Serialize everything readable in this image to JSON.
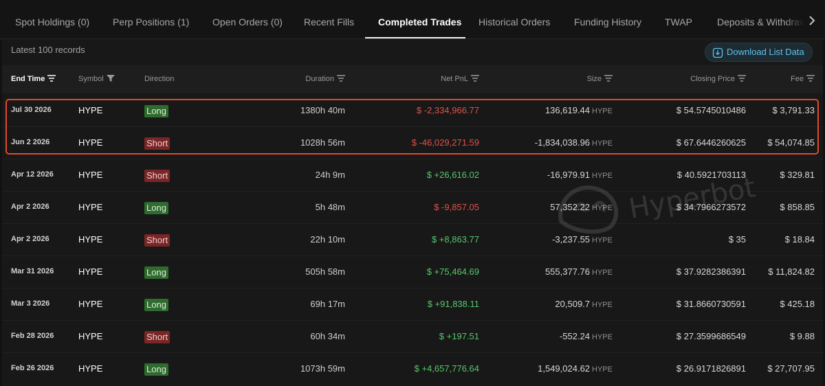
{
  "tabs": [
    {
      "label": "Spot Holdings (0)"
    },
    {
      "label": "Perp Positions (1)"
    },
    {
      "label": "Open Orders (0)"
    },
    {
      "label": "Recent Fills"
    },
    {
      "label": "Completed Trades"
    },
    {
      "label": "Historical Orders"
    },
    {
      "label": "Funding History"
    },
    {
      "label": "TWAP"
    },
    {
      "label": "Deposits & Withdrav"
    }
  ],
  "active_tab": "Completed Trades",
  "records_label": "Latest 100 records",
  "download_label": "Download List Data",
  "columns": {
    "end_time": "End Time",
    "symbol": "Symbol",
    "direction": "Direction",
    "duration": "Duration",
    "net_pnl": "Net PnL",
    "size": "Size",
    "closing_price": "Closing Price",
    "fee": "Fee"
  },
  "size_unit": "HYPE",
  "watermark": "Hyperbot",
  "colors": {
    "long": "#2f6b2f",
    "short": "#7a2626",
    "pnl_positive": "#55c96b",
    "pnl_negative": "#e0524a",
    "highlight": "#e34a2a",
    "accent": "#5cc4ee"
  },
  "rows": [
    {
      "date": "Jul 30 2026",
      "symbol": "HYPE",
      "direction": "Long",
      "duration": "1380h 40m",
      "pnl": "$ -2,334,966.77",
      "pnl_sign": "neg",
      "size": "136,619.44",
      "price": "$ 54.5745010486",
      "fee": "$ 3,791.33"
    },
    {
      "date": "Jun 2 2026",
      "symbol": "HYPE",
      "direction": "Short",
      "duration": "1028h 56m",
      "pnl": "$ -46,029,271.59",
      "pnl_sign": "neg",
      "size": "-1,834,038.96",
      "price": "$ 67.6446260625",
      "fee": "$ 54,074.85"
    },
    {
      "date": "Apr 12 2026",
      "symbol": "HYPE",
      "direction": "Short",
      "duration": "24h 9m",
      "pnl": "$ +26,616.02",
      "pnl_sign": "pos",
      "size": "-16,979.91",
      "price": "$ 40.5921703113",
      "fee": "$ 329.81"
    },
    {
      "date": "Apr 2 2026",
      "symbol": "HYPE",
      "direction": "Long",
      "duration": "5h 48m",
      "pnl": "$ -9,857.05",
      "pnl_sign": "neg",
      "size": "57,352.22",
      "price": "$ 34.7966273572",
      "fee": "$ 858.85"
    },
    {
      "date": "Apr 2 2026",
      "symbol": "HYPE",
      "direction": "Short",
      "duration": "22h 10m",
      "pnl": "$ +8,863.77",
      "pnl_sign": "pos",
      "size": "-3,237.55",
      "price": "$ 35",
      "fee": "$ 18.84"
    },
    {
      "date": "Mar 31 2026",
      "symbol": "HYPE",
      "direction": "Long",
      "duration": "505h 58m",
      "pnl": "$ +75,464.69",
      "pnl_sign": "pos",
      "size": "555,377.76",
      "price": "$ 37.9282386391",
      "fee": "$ 11,824.82"
    },
    {
      "date": "Mar 3 2026",
      "symbol": "HYPE",
      "direction": "Long",
      "duration": "69h 17m",
      "pnl": "$ +91,838.11",
      "pnl_sign": "pos",
      "size": "20,509.7",
      "price": "$ 31.8660730591",
      "fee": "$ 425.18"
    },
    {
      "date": "Feb 28 2026",
      "symbol": "HYPE",
      "direction": "Short",
      "duration": "60h 34m",
      "pnl": "$ +197.51",
      "pnl_sign": "pos",
      "size": "-552.24",
      "price": "$ 27.3599686549",
      "fee": "$ 9.88"
    },
    {
      "date": "Feb 26 2026",
      "symbol": "HYPE",
      "direction": "Long",
      "duration": "1073h 59m",
      "pnl": "$ +4,657,776.64",
      "pnl_sign": "pos",
      "size": "1,549,024.62",
      "price": "$ 26.9171826891",
      "fee": "$ 27,707.95"
    }
  ]
}
